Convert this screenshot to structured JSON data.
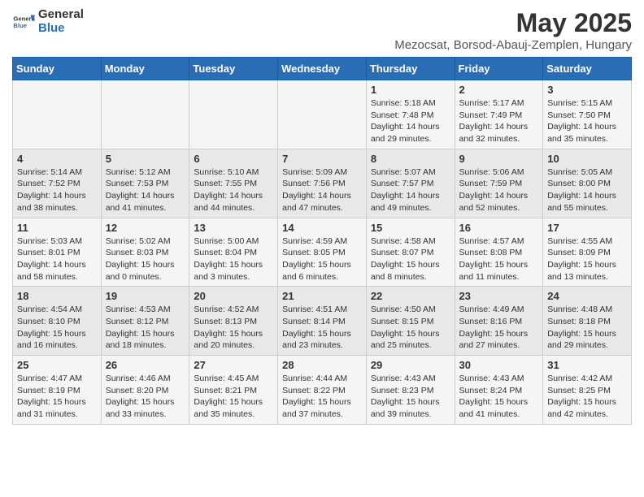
{
  "header": {
    "logo_general": "General",
    "logo_blue": "Blue",
    "title": "May 2025",
    "subtitle": "Mezocsat, Borsod-Abauj-Zemplen, Hungary"
  },
  "days_of_week": [
    "Sunday",
    "Monday",
    "Tuesday",
    "Wednesday",
    "Thursday",
    "Friday",
    "Saturday"
  ],
  "weeks": [
    [
      {
        "day": "",
        "info": ""
      },
      {
        "day": "",
        "info": ""
      },
      {
        "day": "",
        "info": ""
      },
      {
        "day": "",
        "info": ""
      },
      {
        "day": "1",
        "info": "Sunrise: 5:18 AM\nSunset: 7:48 PM\nDaylight: 14 hours and 29 minutes."
      },
      {
        "day": "2",
        "info": "Sunrise: 5:17 AM\nSunset: 7:49 PM\nDaylight: 14 hours and 32 minutes."
      },
      {
        "day": "3",
        "info": "Sunrise: 5:15 AM\nSunset: 7:50 PM\nDaylight: 14 hours and 35 minutes."
      }
    ],
    [
      {
        "day": "4",
        "info": "Sunrise: 5:14 AM\nSunset: 7:52 PM\nDaylight: 14 hours and 38 minutes."
      },
      {
        "day": "5",
        "info": "Sunrise: 5:12 AM\nSunset: 7:53 PM\nDaylight: 14 hours and 41 minutes."
      },
      {
        "day": "6",
        "info": "Sunrise: 5:10 AM\nSunset: 7:55 PM\nDaylight: 14 hours and 44 minutes."
      },
      {
        "day": "7",
        "info": "Sunrise: 5:09 AM\nSunset: 7:56 PM\nDaylight: 14 hours and 47 minutes."
      },
      {
        "day": "8",
        "info": "Sunrise: 5:07 AM\nSunset: 7:57 PM\nDaylight: 14 hours and 49 minutes."
      },
      {
        "day": "9",
        "info": "Sunrise: 5:06 AM\nSunset: 7:59 PM\nDaylight: 14 hours and 52 minutes."
      },
      {
        "day": "10",
        "info": "Sunrise: 5:05 AM\nSunset: 8:00 PM\nDaylight: 14 hours and 55 minutes."
      }
    ],
    [
      {
        "day": "11",
        "info": "Sunrise: 5:03 AM\nSunset: 8:01 PM\nDaylight: 14 hours and 58 minutes."
      },
      {
        "day": "12",
        "info": "Sunrise: 5:02 AM\nSunset: 8:03 PM\nDaylight: 15 hours and 0 minutes."
      },
      {
        "day": "13",
        "info": "Sunrise: 5:00 AM\nSunset: 8:04 PM\nDaylight: 15 hours and 3 minutes."
      },
      {
        "day": "14",
        "info": "Sunrise: 4:59 AM\nSunset: 8:05 PM\nDaylight: 15 hours and 6 minutes."
      },
      {
        "day": "15",
        "info": "Sunrise: 4:58 AM\nSunset: 8:07 PM\nDaylight: 15 hours and 8 minutes."
      },
      {
        "day": "16",
        "info": "Sunrise: 4:57 AM\nSunset: 8:08 PM\nDaylight: 15 hours and 11 minutes."
      },
      {
        "day": "17",
        "info": "Sunrise: 4:55 AM\nSunset: 8:09 PM\nDaylight: 15 hours and 13 minutes."
      }
    ],
    [
      {
        "day": "18",
        "info": "Sunrise: 4:54 AM\nSunset: 8:10 PM\nDaylight: 15 hours and 16 minutes."
      },
      {
        "day": "19",
        "info": "Sunrise: 4:53 AM\nSunset: 8:12 PM\nDaylight: 15 hours and 18 minutes."
      },
      {
        "day": "20",
        "info": "Sunrise: 4:52 AM\nSunset: 8:13 PM\nDaylight: 15 hours and 20 minutes."
      },
      {
        "day": "21",
        "info": "Sunrise: 4:51 AM\nSunset: 8:14 PM\nDaylight: 15 hours and 23 minutes."
      },
      {
        "day": "22",
        "info": "Sunrise: 4:50 AM\nSunset: 8:15 PM\nDaylight: 15 hours and 25 minutes."
      },
      {
        "day": "23",
        "info": "Sunrise: 4:49 AM\nSunset: 8:16 PM\nDaylight: 15 hours and 27 minutes."
      },
      {
        "day": "24",
        "info": "Sunrise: 4:48 AM\nSunset: 8:18 PM\nDaylight: 15 hours and 29 minutes."
      }
    ],
    [
      {
        "day": "25",
        "info": "Sunrise: 4:47 AM\nSunset: 8:19 PM\nDaylight: 15 hours and 31 minutes."
      },
      {
        "day": "26",
        "info": "Sunrise: 4:46 AM\nSunset: 8:20 PM\nDaylight: 15 hours and 33 minutes."
      },
      {
        "day": "27",
        "info": "Sunrise: 4:45 AM\nSunset: 8:21 PM\nDaylight: 15 hours and 35 minutes."
      },
      {
        "day": "28",
        "info": "Sunrise: 4:44 AM\nSunset: 8:22 PM\nDaylight: 15 hours and 37 minutes."
      },
      {
        "day": "29",
        "info": "Sunrise: 4:43 AM\nSunset: 8:23 PM\nDaylight: 15 hours and 39 minutes."
      },
      {
        "day": "30",
        "info": "Sunrise: 4:43 AM\nSunset: 8:24 PM\nDaylight: 15 hours and 41 minutes."
      },
      {
        "day": "31",
        "info": "Sunrise: 4:42 AM\nSunset: 8:25 PM\nDaylight: 15 hours and 42 minutes."
      }
    ]
  ]
}
